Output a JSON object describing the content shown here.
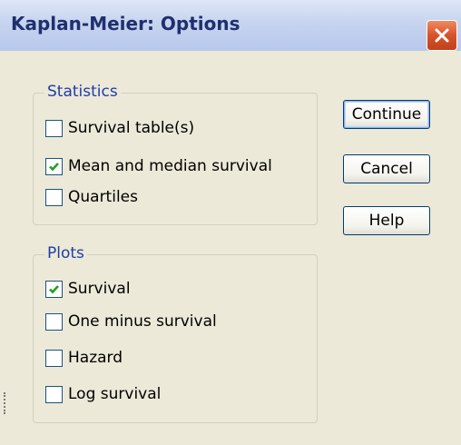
{
  "window": {
    "title": "Kaplan-Meier: Options",
    "close_icon": "close-x-icon"
  },
  "statistics": {
    "label": "Statistics",
    "items": [
      {
        "label": "Survival table(s)",
        "checked": false
      },
      {
        "label": "Mean and median survival",
        "checked": true
      },
      {
        "label": "Quartiles",
        "checked": false
      }
    ]
  },
  "plots": {
    "label": "Plots",
    "items": [
      {
        "label": "Survival",
        "checked": true
      },
      {
        "label": "One minus survival",
        "checked": false
      },
      {
        "label": "Hazard",
        "checked": false
      },
      {
        "label": "Log survival",
        "checked": false
      }
    ]
  },
  "buttons": {
    "continue": "Continue",
    "cancel": "Cancel",
    "help": "Help"
  },
  "colors": {
    "check": "#21a121",
    "group_label": "#1f3ea8",
    "title": "#1f2f6e"
  }
}
